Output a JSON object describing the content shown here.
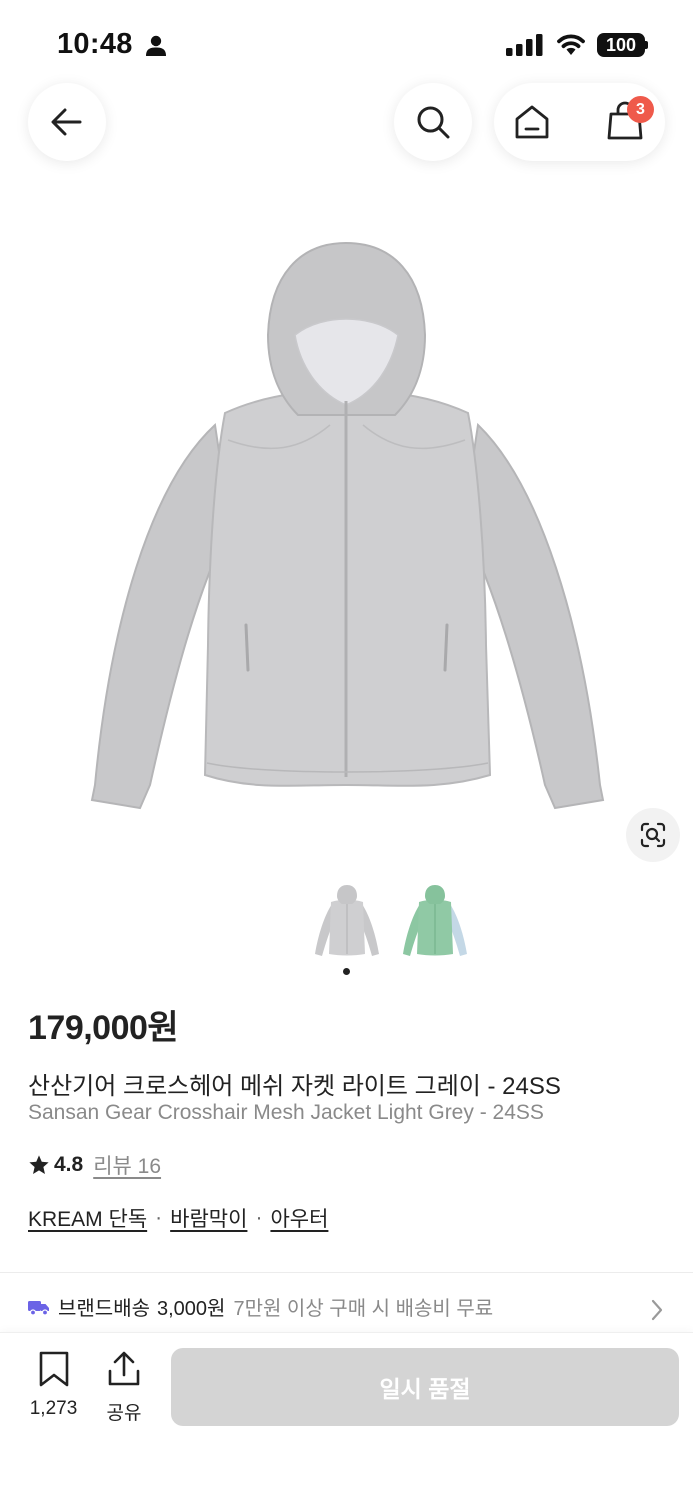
{
  "status_bar": {
    "time": "10:48",
    "battery": "100",
    "icons": [
      "person-icon",
      "signal-icon",
      "wifi-icon",
      "battery-icon"
    ]
  },
  "nav": {
    "icons": [
      "back-arrow-icon",
      "search-icon",
      "home-icon",
      "shopping-bag-icon"
    ],
    "cart_badge": "3"
  },
  "colors": {
    "badge": "#ef5a4b",
    "delivery_icon": "#6b63e6",
    "soldout_button": "#d4d4d4"
  },
  "product": {
    "price": "179,000원",
    "name_ko": "산산기어 크로스헤어 메쉬 자켓 라이트 그레이 - 24SS",
    "name_en": "Sansan Gear Crosshair Mesh Jacket Light Grey - 24SS",
    "rating": "4.8",
    "review": "리뷰 16",
    "thumbnails": [
      "light-grey-jacket",
      "green-jacket"
    ],
    "tags": [
      "KREAM 단독",
      "바람막이",
      "아우터"
    ],
    "tag_separator": "·"
  },
  "shipping": {
    "label": "브랜드배송",
    "fee": "3,000원",
    "note": "7만원 이상 구매 시 배송비 무료"
  },
  "bottom_bar": {
    "bookmark_count": "1,273",
    "share_label": "공유",
    "buy_button": "일시 품절"
  }
}
